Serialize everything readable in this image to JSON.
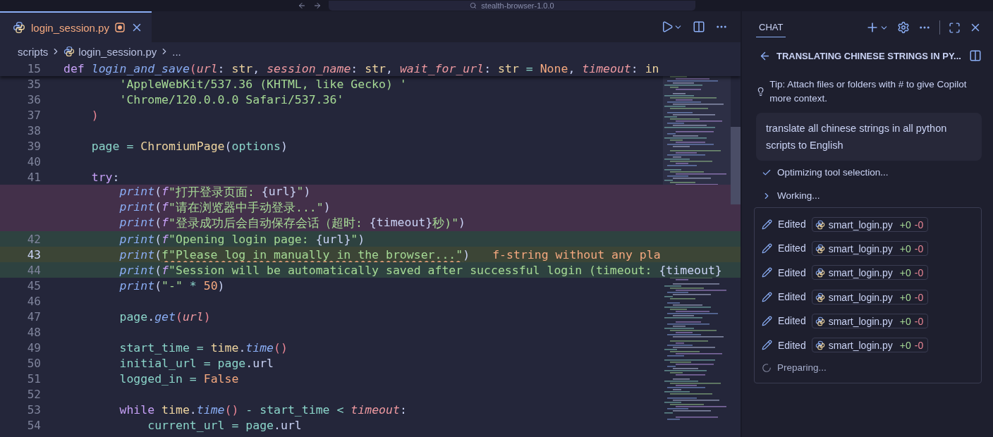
{
  "title_bar": {
    "title": "stealth-browser-1.0.0"
  },
  "editor_tabs": [
    {
      "label": "login_session.py",
      "selected": true,
      "modified": true
    }
  ],
  "breadcrumbs": [
    "scripts",
    "login_session.py",
    "..."
  ],
  "sticky_line": {
    "number": "15",
    "tokens": [
      {
        "kind": "keyword",
        "text": "def "
      },
      {
        "kind": "function",
        "text": "login_and_save"
      },
      {
        "kind": "paren",
        "text": "("
      },
      {
        "kind": "param",
        "text": "url"
      },
      {
        "kind": "plain",
        "text": ": "
      },
      {
        "kind": "type",
        "text": "str"
      },
      {
        "kind": "plain",
        "text": ", "
      },
      {
        "kind": "param",
        "text": "session_name"
      },
      {
        "kind": "plain",
        "text": ": "
      },
      {
        "kind": "type",
        "text": "str"
      },
      {
        "kind": "plain",
        "text": ", "
      },
      {
        "kind": "param",
        "text": "wait_for_url"
      },
      {
        "kind": "plain",
        "text": ": "
      },
      {
        "kind": "type",
        "text": "str"
      },
      {
        "kind": "operator",
        "text": " = "
      },
      {
        "kind": "constant",
        "text": "None"
      },
      {
        "kind": "plain",
        "text": ", "
      },
      {
        "kind": "param",
        "text": "timeout"
      },
      {
        "kind": "plain",
        "text": ": "
      },
      {
        "kind": "type",
        "text": "in"
      }
    ]
  },
  "code_lines": [
    {
      "number": "35",
      "kind": "context",
      "tokens": [
        {
          "kind": "string",
          "text": "        'AppleWebKit/537.36 (KHTML, like Gecko) '"
        }
      ]
    },
    {
      "number": "36",
      "kind": "context",
      "tokens": [
        {
          "kind": "string",
          "text": "        'Chrome/120.0.0.0 Safari/537.36'"
        }
      ]
    },
    {
      "number": "37",
      "kind": "context",
      "tokens": [
        {
          "kind": "paren",
          "text": "    )"
        }
      ]
    },
    {
      "number": "38",
      "kind": "context"
    },
    {
      "number": "39",
      "kind": "context",
      "tokens": [
        {
          "kind": "variable",
          "text": "    page"
        },
        {
          "kind": "operator",
          "text": " = "
        },
        {
          "kind": "class",
          "text": "ChromiumPage"
        },
        {
          "kind": "plain",
          "text": "("
        },
        {
          "kind": "variable",
          "text": "options"
        },
        {
          "kind": "plain",
          "text": ")"
        }
      ]
    },
    {
      "number": "40",
      "kind": "context"
    },
    {
      "number": "41",
      "kind": "context",
      "tokens": [
        {
          "kind": "keyword",
          "text": "    try"
        },
        {
          "kind": "plain",
          "text": ":"
        }
      ]
    },
    {
      "kind": "deleted",
      "tokens": [
        {
          "kind": "builtin",
          "text": "        print"
        },
        {
          "kind": "plain",
          "text": "("
        },
        {
          "kind": "fprefix",
          "text": "f"
        },
        {
          "kind": "string",
          "text": "\"打开登录页面: "
        },
        {
          "kind": "plain",
          "text": "{url}"
        },
        {
          "kind": "string",
          "text": "\""
        },
        {
          "kind": "plain",
          "text": ")"
        }
      ]
    },
    {
      "kind": "deleted",
      "tokens": [
        {
          "kind": "builtin",
          "text": "        print"
        },
        {
          "kind": "plain",
          "text": "("
        },
        {
          "kind": "fprefix",
          "text": "f"
        },
        {
          "kind": "string",
          "text": "\"请在浏览器中手动登录...\""
        },
        {
          "kind": "plain",
          "text": ")"
        }
      ]
    },
    {
      "kind": "deleted",
      "tokens": [
        {
          "kind": "builtin",
          "text": "        print"
        },
        {
          "kind": "plain",
          "text": "("
        },
        {
          "kind": "fprefix",
          "text": "f"
        },
        {
          "kind": "string",
          "text": "\"登录成功后会自动保存会话（超时: "
        },
        {
          "kind": "plain",
          "text": "{timeout}"
        },
        {
          "kind": "string",
          "text": "秒)\""
        },
        {
          "kind": "plain",
          "text": ")"
        }
      ]
    },
    {
      "number": "42",
      "kind": "added",
      "tokens": [
        {
          "kind": "builtin",
          "text": "        print"
        },
        {
          "kind": "plain",
          "text": "("
        },
        {
          "kind": "fprefix",
          "text": "f"
        },
        {
          "kind": "string",
          "text": "\"Opening login page: "
        },
        {
          "kind": "plain",
          "text": "{url}"
        },
        {
          "kind": "string",
          "text": "\""
        },
        {
          "kind": "plain",
          "text": ")"
        }
      ]
    },
    {
      "number": "43",
      "kind": "current",
      "diagnostic": "f-string without any pla",
      "tokens": [
        {
          "kind": "builtin",
          "text": "        print"
        },
        {
          "kind": "plain",
          "text": "("
        },
        {
          "kind": "warning",
          "text": "f\"Please log in manually in the browser...\""
        },
        {
          "kind": "plain",
          "text": ")"
        }
      ]
    },
    {
      "number": "44",
      "kind": "added",
      "tokens": [
        {
          "kind": "builtin",
          "text": "        print"
        },
        {
          "kind": "plain",
          "text": "("
        },
        {
          "kind": "fprefix",
          "text": "f"
        },
        {
          "kind": "string",
          "text": "\"Session will be automatically saved after successful login (timeout: "
        },
        {
          "kind": "plain",
          "text": "{timeout}"
        }
      ]
    },
    {
      "number": "45",
      "kind": "context",
      "tokens": [
        {
          "kind": "builtin",
          "text": "        print"
        },
        {
          "kind": "plain",
          "text": "("
        },
        {
          "kind": "string",
          "text": "\"-\""
        },
        {
          "kind": "operator",
          "text": " * "
        },
        {
          "kind": "constant",
          "text": "50"
        },
        {
          "kind": "plain",
          "text": ")"
        }
      ]
    },
    {
      "number": "46",
      "kind": "context"
    },
    {
      "number": "47",
      "kind": "context",
      "tokens": [
        {
          "kind": "variable",
          "text": "        page"
        },
        {
          "kind": "plain",
          "text": "."
        },
        {
          "kind": "function",
          "text": "get"
        },
        {
          "kind": "paren",
          "text": "("
        },
        {
          "kind": "param",
          "text": "url"
        },
        {
          "kind": "paren",
          "text": ")"
        }
      ]
    },
    {
      "number": "48",
      "kind": "context"
    },
    {
      "number": "49",
      "kind": "context",
      "tokens": [
        {
          "kind": "variable",
          "text": "        start_time"
        },
        {
          "kind": "operator",
          "text": " = "
        },
        {
          "kind": "module",
          "text": "time"
        },
        {
          "kind": "plain",
          "text": "."
        },
        {
          "kind": "function",
          "text": "time"
        },
        {
          "kind": "paren",
          "text": "()"
        }
      ]
    },
    {
      "number": "50",
      "kind": "context",
      "tokens": [
        {
          "kind": "variable",
          "text": "        initial_url"
        },
        {
          "kind": "operator",
          "text": " = "
        },
        {
          "kind": "variable",
          "text": "page"
        },
        {
          "kind": "plain",
          "text": ".url"
        }
      ]
    },
    {
      "number": "51",
      "kind": "context",
      "tokens": [
        {
          "kind": "variable",
          "text": "        logged_in"
        },
        {
          "kind": "operator",
          "text": " = "
        },
        {
          "kind": "constant",
          "text": "False"
        }
      ]
    },
    {
      "number": "52",
      "kind": "context"
    },
    {
      "number": "53",
      "kind": "context",
      "tokens": [
        {
          "kind": "keyword",
          "text": "        while "
        },
        {
          "kind": "module",
          "text": "time"
        },
        {
          "kind": "plain",
          "text": "."
        },
        {
          "kind": "function",
          "text": "time"
        },
        {
          "kind": "paren",
          "text": "()"
        },
        {
          "kind": "operator",
          "text": " - "
        },
        {
          "kind": "variable",
          "text": "start_time"
        },
        {
          "kind": "operator",
          "text": " < "
        },
        {
          "kind": "param",
          "text": "timeout"
        },
        {
          "kind": "plain",
          "text": ":"
        }
      ]
    },
    {
      "number": "54",
      "kind": "context",
      "tokens": [
        {
          "kind": "variable",
          "text": "            current_url"
        },
        {
          "kind": "operator",
          "text": " = "
        },
        {
          "kind": "variable",
          "text": "page"
        },
        {
          "kind": "plain",
          "text": ".url"
        }
      ]
    }
  ],
  "chat": {
    "tab": {
      "label": "CHAT",
      "selected": true
    },
    "title": "TRANSLATING CHINESE STRINGS IN PY...",
    "tip": "Tip: Attach files or folders with # to give Copilot more context.",
    "user_message": "translate all chinese strings in all python scripts to English",
    "progress": [
      {
        "kind": "done",
        "text": "Optimizing tool selection..."
      },
      {
        "kind": "collapsed",
        "text": "Working..."
      }
    ],
    "edits": [
      {
        "action": "Edited",
        "file": "smart_login.py",
        "added": "+0",
        "removed": "-0"
      },
      {
        "action": "Edited",
        "file": "smart_login.py",
        "added": "+0",
        "removed": "-0"
      },
      {
        "action": "Edited",
        "file": "smart_login.py",
        "added": "+0",
        "removed": "-0"
      },
      {
        "action": "Edited",
        "file": "smart_login.py",
        "added": "+0",
        "removed": "-0"
      },
      {
        "action": "Edited",
        "file": "smart_login.py",
        "added": "+0",
        "removed": "-0"
      },
      {
        "action": "Edited",
        "file": "smart_login.py",
        "added": "+0",
        "removed": "-0"
      }
    ],
    "status": "Preparing..."
  }
}
